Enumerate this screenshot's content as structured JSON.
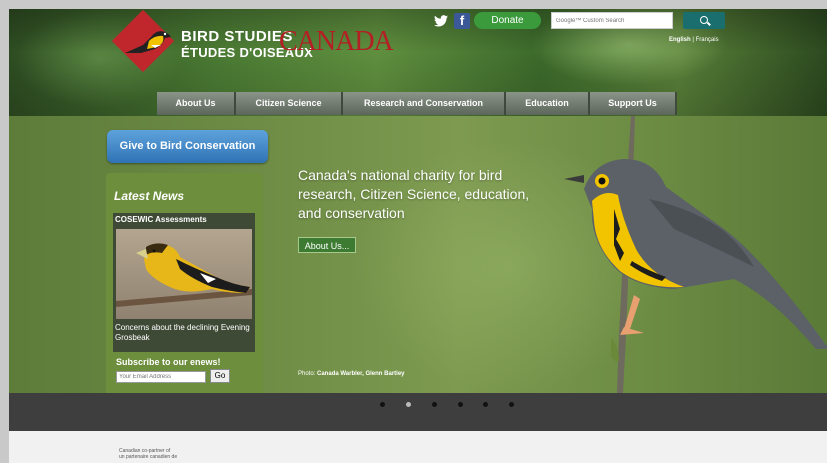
{
  "logo": {
    "line1": "BIRD STUDIES",
    "line2": "ÉTUDES D'OISEAUX",
    "line3": "CANADA",
    "brand_color": "#c0272d"
  },
  "top_bar": {
    "twitter_icon": "twitter-icon",
    "facebook_icon": "facebook-icon",
    "donate_label": "Donate",
    "search_placeholder": "Google™ Custom Search",
    "search_icon": "search-icon",
    "lang_english": "English",
    "lang_separator": " | ",
    "lang_french": "Français"
  },
  "nav": {
    "items": [
      {
        "label": "About Us"
      },
      {
        "label": "Citizen Science"
      },
      {
        "label": "Research and Conservation"
      },
      {
        "label": "Education"
      },
      {
        "label": "Support Us"
      }
    ]
  },
  "sidebar": {
    "give_label": "Give to Bird Conservation",
    "news_title": "Latest News",
    "news_item_title": "COSEWIC Assessments",
    "news_item_caption": "Concerns about the declining Evening Grosbeak",
    "subscribe_label": "Subscribe to our enews!",
    "email_placeholder": "Your Email Address",
    "go_label": "Go"
  },
  "hero": {
    "tagline": "Canada's national charity for bird research, Citizen Science, education, and conservation",
    "about_label": "About Us...",
    "photo_credit_prefix": "Photo: ",
    "photo_credit_name": "Canada Warbler, Glenn Bartley",
    "slides_total": 6,
    "slide_active": 2
  },
  "footer": {
    "partner_en": "Canadian co-partner of",
    "partner_fr": "un partenaire canadien de"
  }
}
